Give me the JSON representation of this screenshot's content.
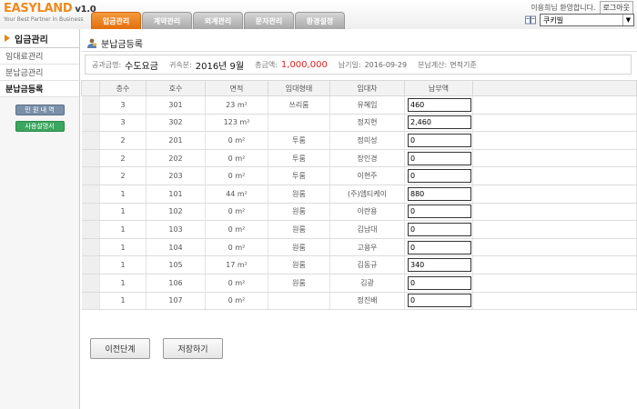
{
  "app": {
    "logo_easy": "EASY",
    "logo_land": "LAND",
    "version": "v1.0",
    "tagline": "Your Best Partner in Business",
    "accent": "#f08a1c"
  },
  "nav": {
    "tabs": [
      "입금관리",
      "계약관리",
      "외계관리",
      "문자관리",
      "환경설정"
    ],
    "active_index": 0
  },
  "header": {
    "greeting": "이용희님 환영합니다.",
    "logout_label": "로그아웃",
    "site_select_value": "쿠키빌",
    "book_icon": "book-icon"
  },
  "sidebar": {
    "title": "입금관리",
    "items": [
      "임대료관리",
      "분납금관리",
      "분납금등록"
    ],
    "active_item": "분납금등록",
    "buttons": {
      "complaint": "민 원 내 역",
      "manual": "사용설명서"
    }
  },
  "page": {
    "title": "분납금등록",
    "title_icon": "person-icon"
  },
  "info": {
    "bill_label": "공과금명:",
    "bill_value": "수도요금",
    "period_label": "귀속분:",
    "period_value": "2016년 9월",
    "total_label": "총금액:",
    "total_value": "1,000,000",
    "due_label": "납기일:",
    "due_value": "2016-09-29",
    "calc_label": "분납계산:",
    "calc_value": "면적기준"
  },
  "table": {
    "headers": [
      "층수",
      "호수",
      "면적",
      "임대형태",
      "임대차",
      "납부액"
    ],
    "area_unit": "m²",
    "rows": [
      {
        "floor": "3",
        "room": "301",
        "area": "23",
        "type": "쓰리룸",
        "tenant": "유혜임",
        "pay": "460"
      },
      {
        "floor": "3",
        "room": "302",
        "area": "123",
        "type": "",
        "tenant": "정지현",
        "pay": "2,460"
      },
      {
        "floor": "2",
        "room": "201",
        "area": "0",
        "type": "투룸",
        "tenant": "정미성",
        "pay": "0"
      },
      {
        "floor": "2",
        "room": "202",
        "area": "0",
        "type": "투룸",
        "tenant": "장인경",
        "pay": "0"
      },
      {
        "floor": "2",
        "room": "203",
        "area": "0",
        "type": "투룸",
        "tenant": "이현주",
        "pay": "0"
      },
      {
        "floor": "1",
        "room": "101",
        "area": "44",
        "type": "원룸",
        "tenant": "(주)엠티케이",
        "pay": "880"
      },
      {
        "floor": "1",
        "room": "102",
        "area": "0",
        "type": "원룸",
        "tenant": "이란용",
        "pay": "0"
      },
      {
        "floor": "1",
        "room": "103",
        "area": "0",
        "type": "원룸",
        "tenant": "김남대",
        "pay": "0"
      },
      {
        "floor": "1",
        "room": "104",
        "area": "0",
        "type": "원룸",
        "tenant": "고용우",
        "pay": "0"
      },
      {
        "floor": "1",
        "room": "105",
        "area": "17",
        "type": "원룸",
        "tenant": "김동규",
        "pay": "340"
      },
      {
        "floor": "1",
        "room": "106",
        "area": "0",
        "type": "원룸",
        "tenant": "김광",
        "pay": "0"
      },
      {
        "floor": "1",
        "room": "107",
        "area": "0",
        "type": "",
        "tenant": "정진배",
        "pay": "0"
      }
    ]
  },
  "actions": {
    "prev_label": "이전단계",
    "save_label": "저장하기"
  }
}
